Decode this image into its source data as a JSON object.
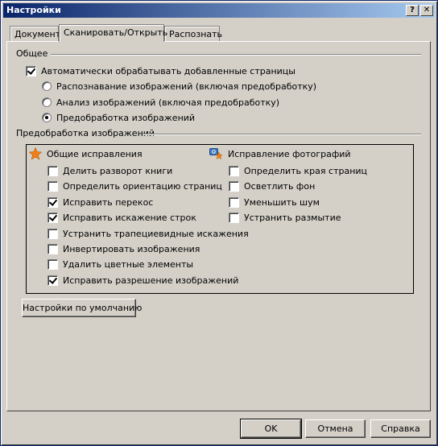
{
  "window": {
    "title": "Настройки",
    "help_label": "?",
    "close_label": "✕"
  },
  "tabs": [
    {
      "label": "Документ",
      "active": false
    },
    {
      "label": "Сканировать/Открыть",
      "active": true
    },
    {
      "label": "Распознать",
      "active": false
    }
  ],
  "general": {
    "title": "Общее",
    "auto_process": {
      "label": "Автоматически обрабатывать добавленные страницы",
      "checked": true
    },
    "radios": [
      {
        "label": "Распознавание изображений (включая предобработку)",
        "checked": false
      },
      {
        "label": "Анализ изображений (включая предобработку)",
        "checked": false
      },
      {
        "label": "Предобработка изображений",
        "checked": true
      }
    ]
  },
  "preprocessing": {
    "title": "Предобработка изображений",
    "general_fixes": {
      "title": "Общие исправления",
      "icon": "star-icon",
      "items": [
        {
          "label": "Делить разворот книги",
          "checked": false
        },
        {
          "label": "Определить ориентацию страниц",
          "checked": false
        },
        {
          "label": "Исправить перекос",
          "checked": true
        },
        {
          "label": "Исправить искажение строк",
          "checked": true
        },
        {
          "label": "Устранить трапециевидные искажения",
          "checked": false
        },
        {
          "label": "Инвертировать изображения",
          "checked": false
        },
        {
          "label": "Удалить цветные элементы",
          "checked": false
        },
        {
          "label": "Исправить разрешение изображений",
          "checked": true
        }
      ]
    },
    "photo_fixes": {
      "title": "Исправление фотографий",
      "icon": "camera-star-icon",
      "items": [
        {
          "label": "Определить края страниц",
          "checked": false
        },
        {
          "label": "Осветлить фон",
          "checked": false
        },
        {
          "label": "Уменьшить шум",
          "checked": false
        },
        {
          "label": "Устранить размытие",
          "checked": false
        }
      ]
    }
  },
  "defaults_button": "Настройки по умолчанию",
  "footer": {
    "ok": "OK",
    "cancel": "Отмена",
    "help": "Справка"
  },
  "colors": {
    "title_start": "#0a246a",
    "title_end": "#a6caf0",
    "face": "#d4d0c8",
    "star": "#f07f1b"
  }
}
